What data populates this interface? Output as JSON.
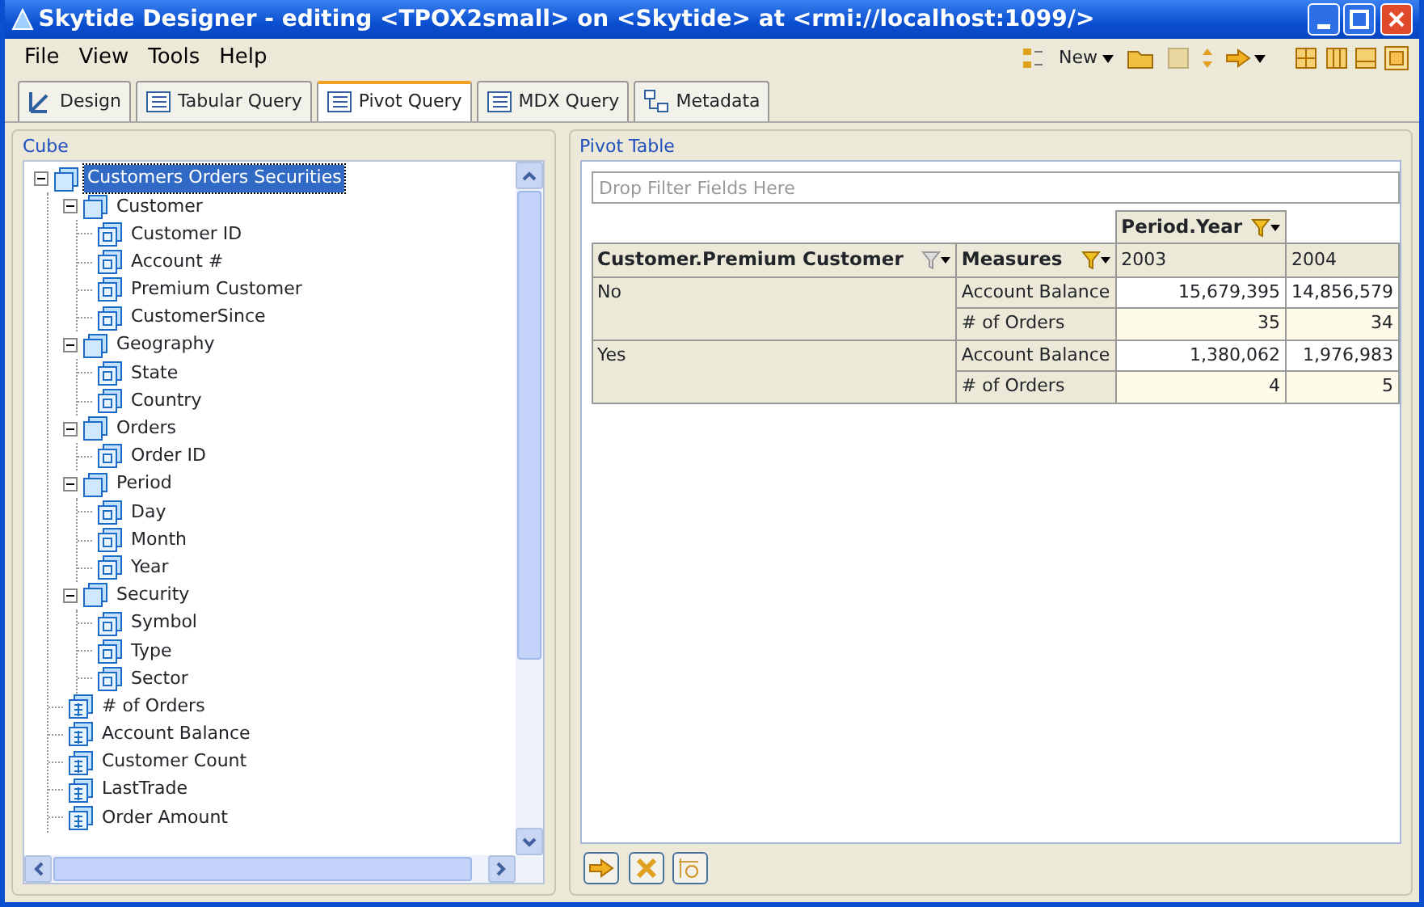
{
  "window": {
    "title": "Skytide Designer - editing <TPOX2small> on <Skytide> at <rmi://localhost:1099/>"
  },
  "menu": [
    "File",
    "View",
    "Tools",
    "Help"
  ],
  "toolbar": {
    "new_button": "New"
  },
  "tabs": [
    {
      "label": "Design",
      "selected": false
    },
    {
      "label": "Tabular Query",
      "selected": false
    },
    {
      "label": "Pivot Query",
      "selected": true
    },
    {
      "label": "MDX Query",
      "selected": false
    },
    {
      "label": "Metadata",
      "selected": false
    }
  ],
  "cube_panel": {
    "title": "Cube",
    "tree": [
      {
        "label": "Customers Orders Securities",
        "kind": "cube",
        "expanded": true,
        "selected": true,
        "children": [
          {
            "label": "Customer",
            "kind": "dimension",
            "expanded": true,
            "selected": false,
            "children": [
              {
                "label": "Customer ID",
                "kind": "level",
                "selected": false
              },
              {
                "label": "Account #",
                "kind": "level",
                "selected": false
              },
              {
                "label": "Premium Customer",
                "kind": "level",
                "selected": false
              },
              {
                "label": "CustomerSince",
                "kind": "level",
                "selected": false
              }
            ]
          },
          {
            "label": "Geography",
            "kind": "dimension",
            "expanded": true,
            "selected": false,
            "children": [
              {
                "label": "State",
                "kind": "level",
                "selected": false
              },
              {
                "label": "Country",
                "kind": "level",
                "selected": false
              }
            ]
          },
          {
            "label": "Orders",
            "kind": "dimension",
            "expanded": true,
            "selected": false,
            "children": [
              {
                "label": "Order ID",
                "kind": "level",
                "selected": false
              }
            ]
          },
          {
            "label": "Period",
            "kind": "dimension",
            "expanded": true,
            "selected": false,
            "children": [
              {
                "label": "Day",
                "kind": "level",
                "selected": false
              },
              {
                "label": "Month",
                "kind": "level",
                "selected": false
              },
              {
                "label": "Year",
                "kind": "level",
                "selected": false
              }
            ]
          },
          {
            "label": "Security",
            "kind": "dimension",
            "expanded": true,
            "selected": false,
            "children": [
              {
                "label": "Symbol",
                "kind": "level",
                "selected": false
              },
              {
                "label": "Type",
                "kind": "level",
                "selected": false
              },
              {
                "label": "Sector",
                "kind": "level",
                "selected": false
              }
            ]
          },
          {
            "label": "# of Orders",
            "kind": "measure",
            "selected": false
          },
          {
            "label": "Account Balance",
            "kind": "measure",
            "selected": false
          },
          {
            "label": "Customer Count",
            "kind": "measure",
            "selected": false
          },
          {
            "label": "LastTrade",
            "kind": "measure",
            "selected": false
          },
          {
            "label": "Order Amount",
            "kind": "measure",
            "selected": false
          }
        ]
      }
    ]
  },
  "pivot_panel": {
    "title": "Pivot Table",
    "filter": {
      "placeholder": "Drop Filter Fields Here"
    },
    "column_field": "Period.Year",
    "row_field": "Customer.Premium Customer",
    "measures_field": "Measures",
    "columns": [
      "2003",
      "2004"
    ],
    "rows": [
      {
        "label": "No",
        "measures": [
          {
            "name": "Account Balance",
            "values": [
              "15,679,395",
              "14,856,579"
            ]
          },
          {
            "name": "# of Orders",
            "values": [
              "35",
              "34"
            ]
          }
        ]
      },
      {
        "label": "Yes",
        "measures": [
          {
            "name": "Account Balance",
            "values": [
              "1,380,062",
              "1,976,983"
            ]
          },
          {
            "name": "# of Orders",
            "values": [
              "4",
              "5"
            ]
          }
        ]
      }
    ]
  }
}
